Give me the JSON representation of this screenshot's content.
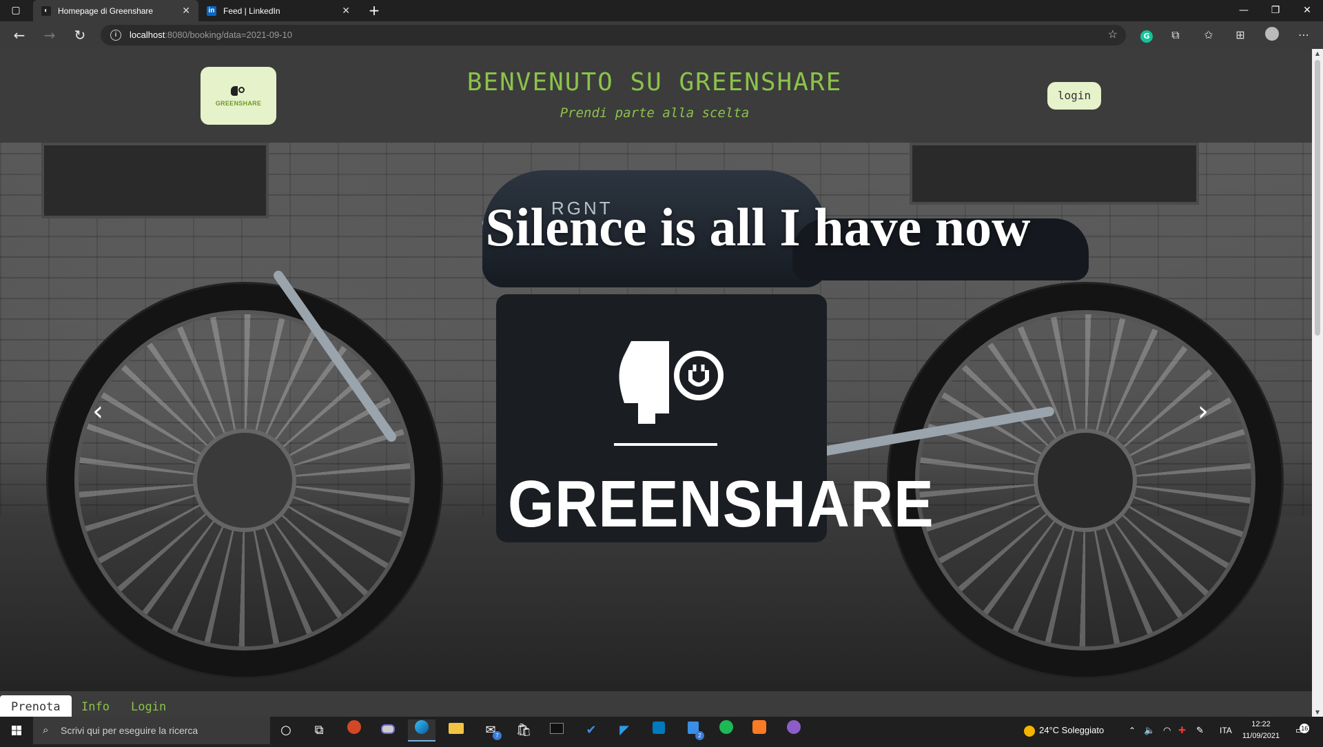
{
  "browser": {
    "tabs": [
      {
        "title": "Homepage di Greenshare",
        "favicon": "greenshare-favicon"
      },
      {
        "title": "Feed | LinkedIn",
        "favicon": "linkedin-favicon"
      }
    ],
    "url": {
      "host": "localhost",
      "rest": ":8080/booking/data=2021-09-10"
    }
  },
  "header": {
    "logo_text": "GREENSHARE",
    "title": "BENVENUTO SU GREENSHARE",
    "subtitle": "Prendi parte alla scelta",
    "login_label": "login"
  },
  "hero": {
    "headline": "Silence is all I have now",
    "brand": "GREENSHARE",
    "tank_text": "RGNT",
    "prev_icon": "chevron-left-icon",
    "next_icon": "chevron-right-icon"
  },
  "bottom_tabs": [
    {
      "label": "Prenota",
      "active": true
    },
    {
      "label": "Info",
      "active": false
    },
    {
      "label": "Login",
      "active": false
    }
  ],
  "taskbar": {
    "search_placeholder": "Scrivi qui per eseguire la ricerca",
    "weather": "24°C  Soleggiato",
    "language": "ITA",
    "time": "12:22",
    "date": "11/09/2021",
    "notification_count": "16",
    "mail_badge": "7",
    "todo_badge": "2"
  },
  "colors": {
    "accent": "#8bc34a",
    "logo_bg": "#e6f2c9",
    "header_bg": "#3c3c3c"
  }
}
